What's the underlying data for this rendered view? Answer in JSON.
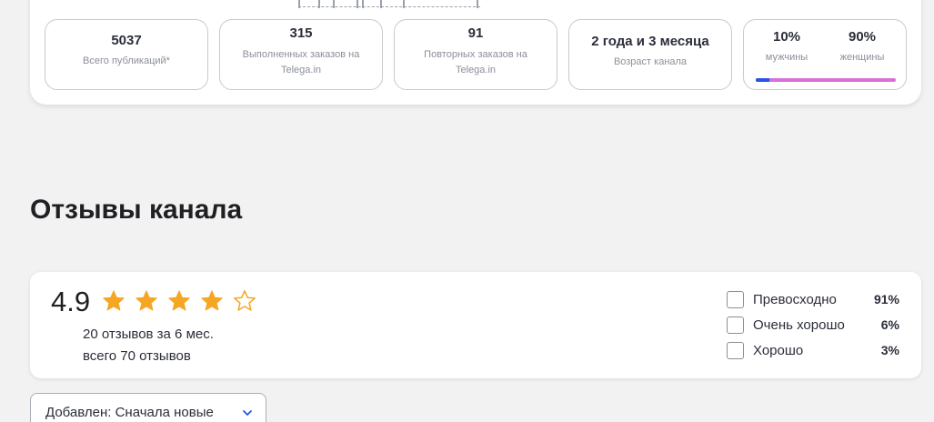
{
  "stats": [
    {
      "value": "5037",
      "label_lines": [
        "Всего публикаций*"
      ]
    },
    {
      "value": "315",
      "label_lines": [
        "Выполненных заказов на",
        "Telega.in"
      ]
    },
    {
      "value": "91",
      "label_lines": [
        "Повторных заказов на",
        "Telega.in"
      ]
    },
    {
      "value": "2 года и 3 месяца",
      "label_lines": [
        "Возраст канала"
      ]
    }
  ],
  "gender": {
    "male_pct": "10%",
    "male_label": "мужчины",
    "female_pct": "90%",
    "female_label": "женщины",
    "male_fraction": 0.1,
    "colors": {
      "male": "#2454e8",
      "female": "#d96fd9"
    }
  },
  "reviews": {
    "title": "Отзывы канала",
    "rating": "4.9",
    "stars_filled": 4,
    "stars_total": 5,
    "count_text": "20 отзывов за 6 мес.",
    "total_text": "всего 70 отзывов",
    "filters": [
      {
        "label": "Превосходно",
        "pct": "91%"
      },
      {
        "label": "Очень хорошо",
        "pct": "6%"
      },
      {
        "label": "Хорошо",
        "pct": "3%"
      }
    ],
    "star_color": "#f5a623"
  },
  "sort": {
    "label": "Добавлен: Сначала новые",
    "icon": "chevron-down-icon"
  }
}
